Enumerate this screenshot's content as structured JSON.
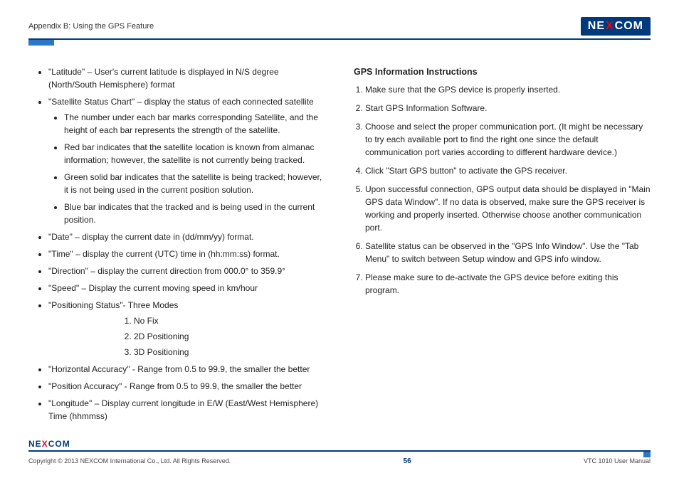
{
  "header": {
    "section": "Appendix B: Using the GPS Feature",
    "brand_pre": "NE",
    "brand_x": "X",
    "brand_post": "COM"
  },
  "left_col": {
    "items": [
      {
        "text": "\"Latitude\" – User's current latitude is displayed in N/S degree (North/South Hemisphere) format"
      },
      {
        "text": "\"Satellite Status Chart\" – display the status of each connected satellite",
        "sub": [
          "The number under each bar marks corresponding Satellite, and the height of each bar represents the strength of the satellite.",
          "Red bar indicates that the satellite location is known from almanac information; however, the satellite is not currently being tracked.",
          "Green solid bar indicates that the satellite is being tracked; however, it is not being used in the current position solution.",
          "Blue bar indicates that the tracked and is being used in the current position."
        ]
      },
      {
        "text": "\"Date\" – display the current date in (dd/mm/yy) format."
      },
      {
        "text": "\"Time\" – display the current (UTC) time in (hh:mm:ss) format."
      },
      {
        "text": "\"Direction\" – display the current direction from 000.0° to 359.9°"
      },
      {
        "text": "\"Speed\" – Display the current moving speed in km/hour"
      },
      {
        "text": "\"Positioning Status\"- Three Modes",
        "modes": [
          "No Fix",
          "2D Positioning",
          "3D Positioning"
        ]
      },
      {
        "text": "\"Horizontal Accuracy\" - Range from 0.5 to 99.9, the smaller the better"
      },
      {
        "text": "\"Position Accuracy\" - Range from 0.5 to 99.9, the smaller the better"
      },
      {
        "text": "\"Longitude\" – Display current longitude in E/W (East/West Hemisphere) Time (hhmmss)"
      }
    ]
  },
  "right_col": {
    "heading": "GPS Information Instructions",
    "steps": [
      "Make sure that the GPS device is properly inserted.",
      "Start GPS Information Software.",
      "Choose and select the proper communication port. (It might be necessary to try each available port to find the right one since the default communication port varies according to different hardware device.)",
      "Click \"Start GPS button\" to activate the GPS receiver.",
      "Upon successful connection, GPS output data should be displayed in \"Main GPS data Window\". If no data is observed, make sure the GPS receiver is working and properly inserted. Otherwise choose another communication port.",
      "Satellite status can be observed in the \"GPS Info Window\". Use the \"Tab Menu\" to switch between Setup window and GPS info window.",
      "Please make sure to de-activate the GPS device before exiting this program."
    ]
  },
  "footer": {
    "brand_pre": "NE",
    "brand_x": "X",
    "brand_post": "COM",
    "copyright": "Copyright © 2013 NEXCOM International Co., Ltd. All Rights Reserved.",
    "page": "56",
    "doc": "VTC 1010 User Manual"
  }
}
